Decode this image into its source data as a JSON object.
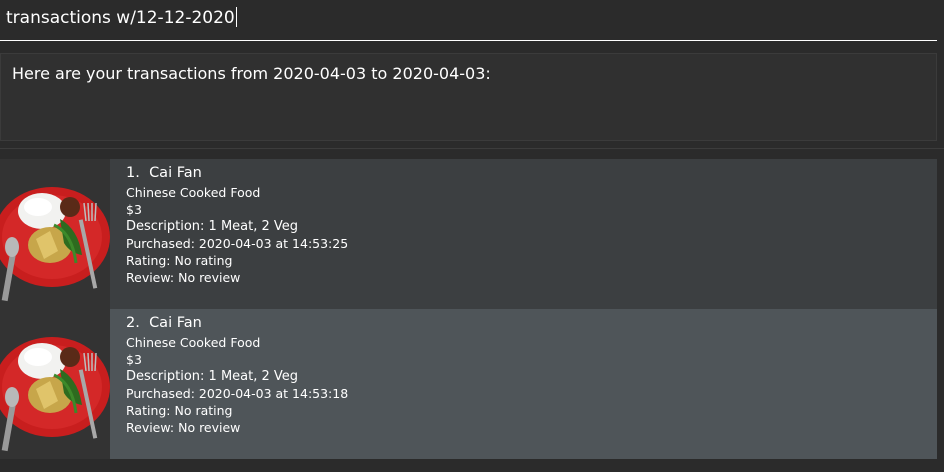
{
  "command": {
    "text": "transactions w/12-12-2020"
  },
  "result": {
    "message": "Here are your transactions from 2020-04-03 to 2020-04-03:"
  },
  "transactions": [
    {
      "index": "1.",
      "name": "Cai Fan",
      "category": "Chinese Cooked Food",
      "price": "$3",
      "description": "Description: 1 Meat, 2 Veg",
      "purchased": "Purchased: 2020-04-03 at 14:53:25",
      "rating": "Rating: No rating",
      "review": "Review: No review"
    },
    {
      "index": "2.",
      "name": "Cai Fan",
      "category": "Chinese Cooked Food",
      "price": "$3",
      "description": "Description: 1 Meat, 2 Veg",
      "purchased": "Purchased: 2020-04-03 at 14:53:18",
      "rating": "Rating: No rating",
      "review": "Review: No review"
    }
  ]
}
